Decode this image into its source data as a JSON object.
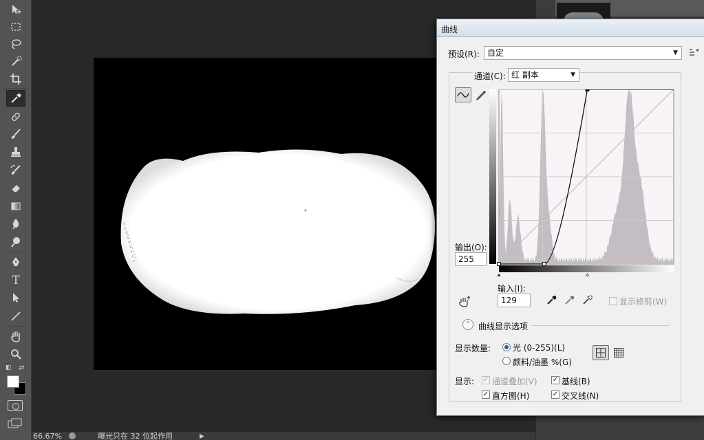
{
  "tools": [
    {
      "name": "move-tool-icon"
    },
    {
      "name": "marquee-tool-icon"
    },
    {
      "name": "lasso-tool-icon"
    },
    {
      "name": "quick-selection-tool-icon"
    },
    {
      "name": "crop-tool-icon"
    },
    {
      "name": "eyedropper-tool-icon",
      "active": true
    },
    {
      "name": "healing-brush-tool-icon"
    },
    {
      "name": "brush-tool-icon"
    },
    {
      "name": "clone-stamp-tool-icon"
    },
    {
      "name": "history-brush-tool-icon"
    },
    {
      "name": "eraser-tool-icon"
    },
    {
      "name": "gradient-tool-icon"
    },
    {
      "name": "blur-tool-icon"
    },
    {
      "name": "dodge-tool-icon"
    },
    {
      "name": "pen-tool-icon"
    },
    {
      "name": "type-tool-icon"
    },
    {
      "name": "path-selection-tool-icon"
    },
    {
      "name": "line-tool-icon"
    },
    {
      "name": "hand-tool-icon"
    },
    {
      "name": "zoom-tool-icon"
    }
  ],
  "status": {
    "zoom": "66.67%",
    "text": "曝光只在 32 位起作用"
  },
  "dialog": {
    "title": "曲线",
    "preset_label": "预设(R):",
    "preset_value": "自定",
    "channel_label": "通道(C):",
    "channel_value": "红 副本",
    "output_label": "输出(O):",
    "output_value": "255",
    "input_label": "输入(I):",
    "input_value": "129",
    "show_clipping_label": "显示修剪(W)",
    "show_clipping_checked": false,
    "curve_display_options_label": "曲线显示选项",
    "show_amount_label": "显示数量:",
    "light_option_label": "光 (0-255)(L)",
    "light_option_selected": true,
    "pigment_option_label": "颜料/油墨 %(G)",
    "pigment_option_selected": false,
    "show_label": "显示:",
    "channel_overlays_label": "通道叠加(V)",
    "channel_overlays_checked": true,
    "channel_overlays_enabled": false,
    "baseline_label": "基线(B)",
    "baseline_checked": true,
    "histogram_label": "直方图(H)",
    "histogram_checked": true,
    "intersection_label": "交叉线(N)",
    "intersection_checked": true,
    "grid_mode": "4x4",
    "check_mark": "✓",
    "expander_glyph": "⌃",
    "dropdown_arrow": "▼"
  },
  "curve_points": [
    [
      0,
      0
    ],
    [
      129,
      255
    ]
  ],
  "colors": {
    "grid_line": "#c9c9c9",
    "histogram_fill": "#c4bec4",
    "curve": "#111111",
    "graph_bg": "#f7f3f7"
  }
}
